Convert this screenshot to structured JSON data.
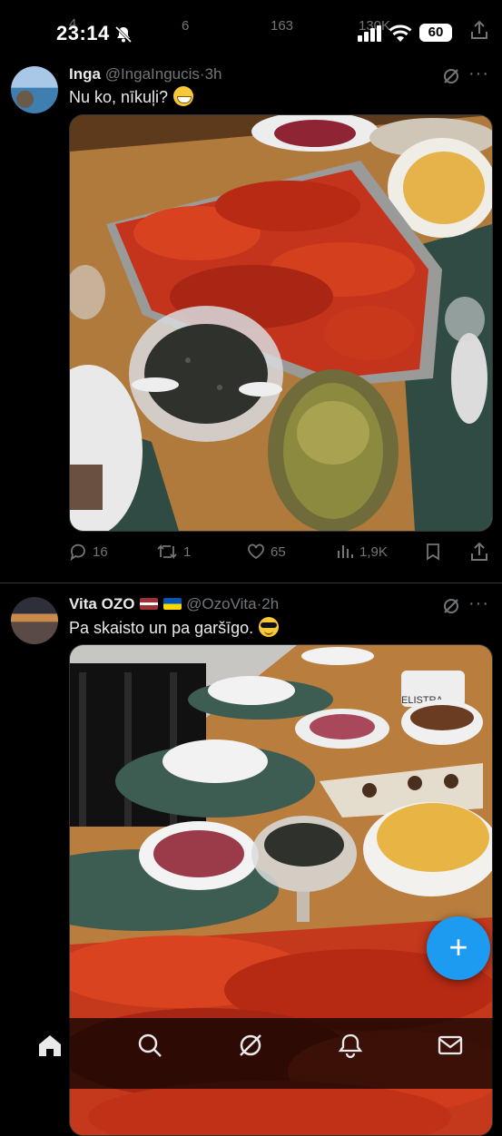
{
  "status_bar": {
    "time": "23:14",
    "battery": "60"
  },
  "prev_post": {
    "replies": "4",
    "reposts": "6",
    "likes": "163",
    "views": "130K"
  },
  "posts": [
    {
      "display_name": "Inga",
      "handle": "@IngaIngucis",
      "separator": "·",
      "time": "3h",
      "text": "Nu ko, nīkuļi?",
      "emoji": "grinning-face-emoji",
      "replies": "16",
      "reposts": "1",
      "likes": "65",
      "views": "1,9K"
    },
    {
      "display_name": "Vita OZO",
      "flags": [
        "latvia-flag",
        "ukraine-flag"
      ],
      "handle": "@OzoVita",
      "separator": "·",
      "time": "2h",
      "text": "Pa skaisto un pa garšīgo.",
      "emoji": "sunglasses-face-emoji",
      "photo_label": "ELISTRA"
    }
  ],
  "fab_label": "+",
  "tabs": [
    "home-icon",
    "search-icon",
    "grok-icon",
    "notifications-icon",
    "messages-icon"
  ],
  "colors": {
    "background": "#000000",
    "text": "#e7e9ea",
    "muted": "#71767b",
    "accent": "#1d9bf0"
  }
}
